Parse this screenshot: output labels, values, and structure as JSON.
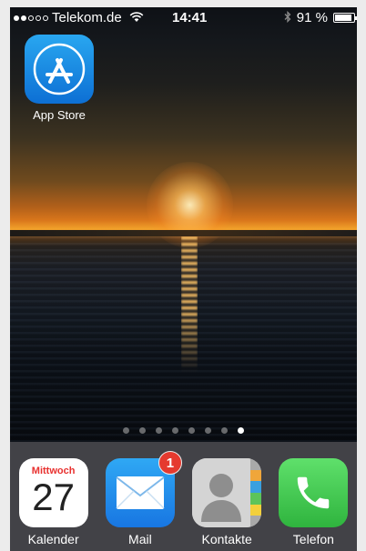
{
  "status_bar": {
    "carrier": "Telekom.de",
    "signal_bars_filled": 2,
    "signal_bars_total": 5,
    "time": "14:41",
    "battery_text": "91 %",
    "battery_level": 0.91,
    "icons": [
      "wifi-icon",
      "bluetooth-icon",
      "battery-icon"
    ]
  },
  "home_apps": [
    {
      "label": "App Store",
      "icon": "app-store-icon"
    }
  ],
  "page_indicator": {
    "pages": 8,
    "current": 8
  },
  "dock": {
    "calendar": {
      "label": "Kalender",
      "weekday": "Mittwoch",
      "date": "27"
    },
    "mail": {
      "label": "Mail",
      "badge": "1"
    },
    "contacts": {
      "label": "Kontakte"
    },
    "phone": {
      "label": "Telefon"
    }
  },
  "colors": {
    "badge": "#e53a2f",
    "calendar_weekday": "#e8312f",
    "app_store": "#1a8ae6",
    "phone": "#3cc64c"
  }
}
